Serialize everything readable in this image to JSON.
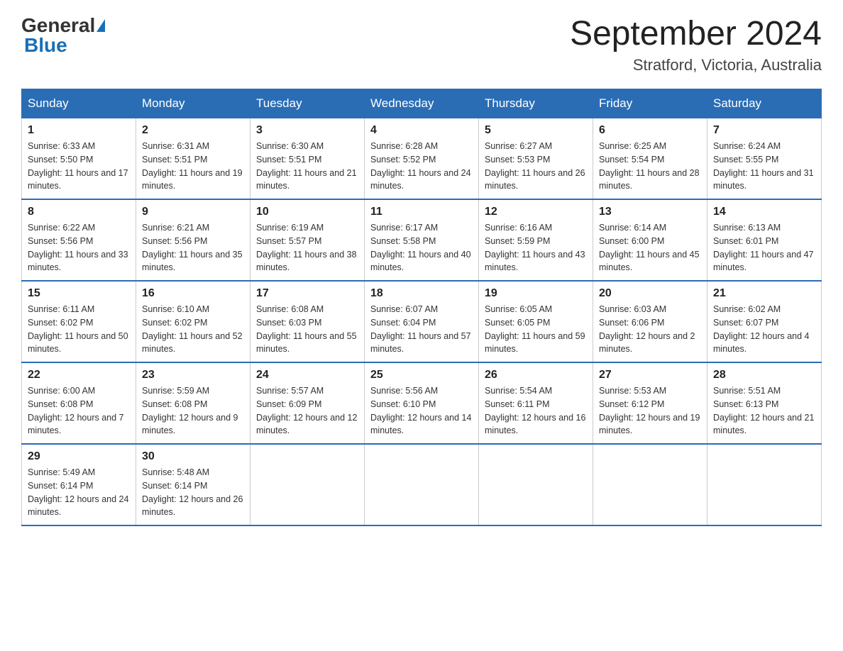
{
  "header": {
    "logo_general": "General",
    "logo_blue": "Blue",
    "month_title": "September 2024",
    "location": "Stratford, Victoria, Australia"
  },
  "days_of_week": [
    "Sunday",
    "Monday",
    "Tuesday",
    "Wednesday",
    "Thursday",
    "Friday",
    "Saturday"
  ],
  "weeks": [
    [
      {
        "day": "1",
        "sunrise": "6:33 AM",
        "sunset": "5:50 PM",
        "daylight": "11 hours and 17 minutes."
      },
      {
        "day": "2",
        "sunrise": "6:31 AM",
        "sunset": "5:51 PM",
        "daylight": "11 hours and 19 minutes."
      },
      {
        "day": "3",
        "sunrise": "6:30 AM",
        "sunset": "5:51 PM",
        "daylight": "11 hours and 21 minutes."
      },
      {
        "day": "4",
        "sunrise": "6:28 AM",
        "sunset": "5:52 PM",
        "daylight": "11 hours and 24 minutes."
      },
      {
        "day": "5",
        "sunrise": "6:27 AM",
        "sunset": "5:53 PM",
        "daylight": "11 hours and 26 minutes."
      },
      {
        "day": "6",
        "sunrise": "6:25 AM",
        "sunset": "5:54 PM",
        "daylight": "11 hours and 28 minutes."
      },
      {
        "day": "7",
        "sunrise": "6:24 AM",
        "sunset": "5:55 PM",
        "daylight": "11 hours and 31 minutes."
      }
    ],
    [
      {
        "day": "8",
        "sunrise": "6:22 AM",
        "sunset": "5:56 PM",
        "daylight": "11 hours and 33 minutes."
      },
      {
        "day": "9",
        "sunrise": "6:21 AM",
        "sunset": "5:56 PM",
        "daylight": "11 hours and 35 minutes."
      },
      {
        "day": "10",
        "sunrise": "6:19 AM",
        "sunset": "5:57 PM",
        "daylight": "11 hours and 38 minutes."
      },
      {
        "day": "11",
        "sunrise": "6:17 AM",
        "sunset": "5:58 PM",
        "daylight": "11 hours and 40 minutes."
      },
      {
        "day": "12",
        "sunrise": "6:16 AM",
        "sunset": "5:59 PM",
        "daylight": "11 hours and 43 minutes."
      },
      {
        "day": "13",
        "sunrise": "6:14 AM",
        "sunset": "6:00 PM",
        "daylight": "11 hours and 45 minutes."
      },
      {
        "day": "14",
        "sunrise": "6:13 AM",
        "sunset": "6:01 PM",
        "daylight": "11 hours and 47 minutes."
      }
    ],
    [
      {
        "day": "15",
        "sunrise": "6:11 AM",
        "sunset": "6:02 PM",
        "daylight": "11 hours and 50 minutes."
      },
      {
        "day": "16",
        "sunrise": "6:10 AM",
        "sunset": "6:02 PM",
        "daylight": "11 hours and 52 minutes."
      },
      {
        "day": "17",
        "sunrise": "6:08 AM",
        "sunset": "6:03 PM",
        "daylight": "11 hours and 55 minutes."
      },
      {
        "day": "18",
        "sunrise": "6:07 AM",
        "sunset": "6:04 PM",
        "daylight": "11 hours and 57 minutes."
      },
      {
        "day": "19",
        "sunrise": "6:05 AM",
        "sunset": "6:05 PM",
        "daylight": "11 hours and 59 minutes."
      },
      {
        "day": "20",
        "sunrise": "6:03 AM",
        "sunset": "6:06 PM",
        "daylight": "12 hours and 2 minutes."
      },
      {
        "day": "21",
        "sunrise": "6:02 AM",
        "sunset": "6:07 PM",
        "daylight": "12 hours and 4 minutes."
      }
    ],
    [
      {
        "day": "22",
        "sunrise": "6:00 AM",
        "sunset": "6:08 PM",
        "daylight": "12 hours and 7 minutes."
      },
      {
        "day": "23",
        "sunrise": "5:59 AM",
        "sunset": "6:08 PM",
        "daylight": "12 hours and 9 minutes."
      },
      {
        "day": "24",
        "sunrise": "5:57 AM",
        "sunset": "6:09 PM",
        "daylight": "12 hours and 12 minutes."
      },
      {
        "day": "25",
        "sunrise": "5:56 AM",
        "sunset": "6:10 PM",
        "daylight": "12 hours and 14 minutes."
      },
      {
        "day": "26",
        "sunrise": "5:54 AM",
        "sunset": "6:11 PM",
        "daylight": "12 hours and 16 minutes."
      },
      {
        "day": "27",
        "sunrise": "5:53 AM",
        "sunset": "6:12 PM",
        "daylight": "12 hours and 19 minutes."
      },
      {
        "day": "28",
        "sunrise": "5:51 AM",
        "sunset": "6:13 PM",
        "daylight": "12 hours and 21 minutes."
      }
    ],
    [
      {
        "day": "29",
        "sunrise": "5:49 AM",
        "sunset": "6:14 PM",
        "daylight": "12 hours and 24 minutes."
      },
      {
        "day": "30",
        "sunrise": "5:48 AM",
        "sunset": "6:14 PM",
        "daylight": "12 hours and 26 minutes."
      },
      null,
      null,
      null,
      null,
      null
    ]
  ],
  "labels": {
    "sunrise_prefix": "Sunrise: ",
    "sunset_prefix": "Sunset: ",
    "daylight_prefix": "Daylight: "
  }
}
